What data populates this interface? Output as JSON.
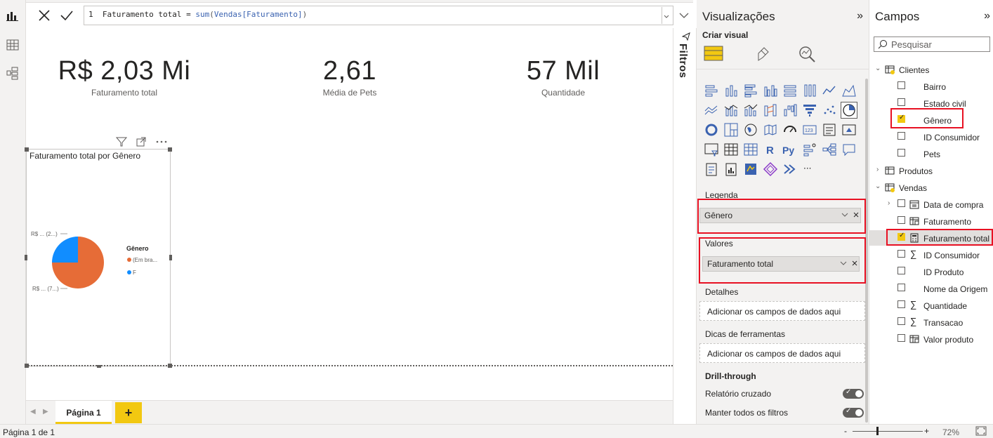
{
  "formula": {
    "line_no": "1",
    "text_prefix": "Faturamento total = ",
    "func": "sum",
    "arg": "Vendas[Faturamento]",
    "open_paren": "(",
    "close_paren": ")"
  },
  "cards": [
    {
      "value": "R$ 2,03 Mi",
      "label": "Faturamento total"
    },
    {
      "value": "2,61",
      "label": "Média de Pets"
    },
    {
      "value": "57 Mil",
      "label": "Quantidade"
    }
  ],
  "pie_visual": {
    "title": "Faturamento total por Gênero",
    "legend_title": "Gênero",
    "legend_items": [
      {
        "label": "(Em bra...",
        "color": "#e66c37"
      },
      {
        "label": "F",
        "color": "#118dff"
      }
    ],
    "label_top": "R$ ... (2...)",
    "label_bottom": "R$ ... (7...)"
  },
  "chart_data": {
    "type": "pie",
    "title": "Faturamento total por Gênero",
    "legend_title": "Gênero",
    "categories": [
      "(Em bra...",
      "F"
    ],
    "values": [
      75,
      25
    ],
    "colors": [
      "#e66c37",
      "#118dff"
    ]
  },
  "filters": {
    "label": "Filtros"
  },
  "pages": {
    "tab": "Página 1",
    "add": "+"
  },
  "status": {
    "page_info": "Página 1 de 1",
    "zoom_minus": "-",
    "zoom_plus": "+",
    "zoom": "72%"
  },
  "viz_pane": {
    "title": "Visualizações",
    "collapse": "»",
    "sub": "Criar visual",
    "legenda": "Legenda",
    "legenda_value": "Gênero",
    "valores": "Valores",
    "valores_value": "Faturamento total",
    "detalhes": "Detalhes",
    "detalhes_placeholder": "Adicionar os campos de dados aqui",
    "dicas": "Dicas de ferramentas",
    "dicas_placeholder": "Adicionar os campos de dados aqui",
    "drill": "Drill-through",
    "relatorio": "Relatório cruzado",
    "manter": "Manter todos os filtros",
    "text_icons": {
      "r": "R",
      "py": "Py",
      "kpi": "123",
      "more": "···"
    }
  },
  "fields_pane": {
    "title": "Campos",
    "collapse": "»",
    "search_placeholder": "Pesquisar",
    "tables": [
      {
        "name": "Clientes",
        "fields": [
          "Bairro",
          "Estado civil",
          "Gênero",
          "ID Consumidor",
          "Pets"
        ]
      },
      {
        "name": "Produtos"
      },
      {
        "name": "Vendas",
        "fields": [
          "Data de compra",
          "Faturamento",
          "Faturamento total",
          "ID Consumidor",
          "ID Produto",
          "Nome da Origem",
          "Quantidade",
          "Transacao",
          "Valor produto"
        ]
      }
    ]
  },
  "colors": {
    "accent": "#f2c811",
    "highlight_red": "#e81123",
    "pie_orange": "#e66c37",
    "pie_blue": "#118dff"
  }
}
